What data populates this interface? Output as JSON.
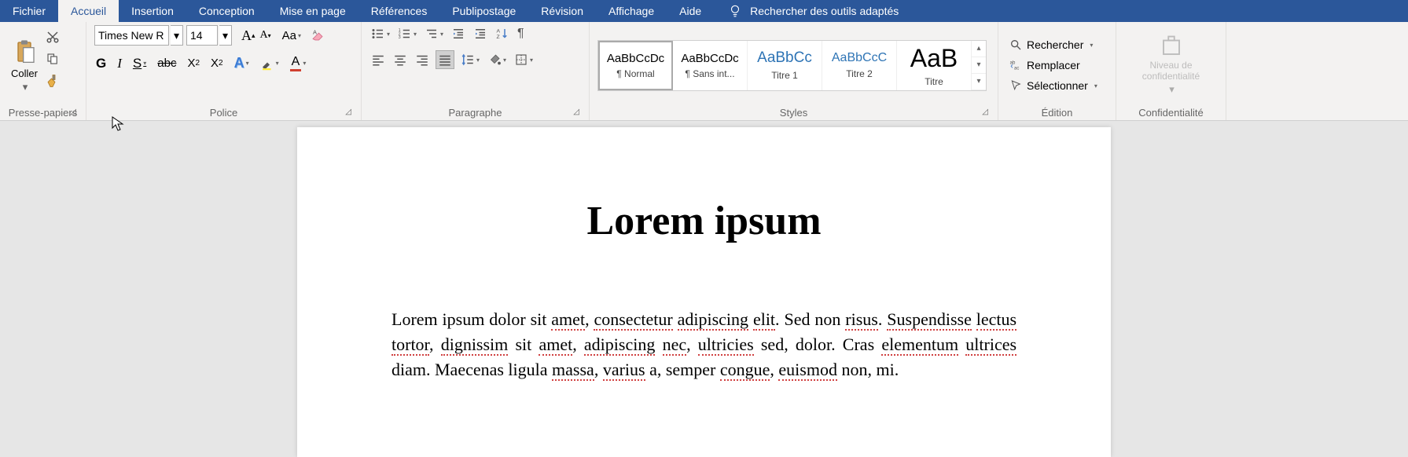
{
  "menu": {
    "fichier": "Fichier",
    "accueil": "Accueil",
    "insertion": "Insertion",
    "conception": "Conception",
    "mise_en_page": "Mise en page",
    "references": "Références",
    "publipostage": "Publipostage",
    "revision": "Révision",
    "affichage": "Affichage",
    "aide": "Aide",
    "tell_me": "Rechercher des outils adaptés"
  },
  "clipboard": {
    "paste": "Coller",
    "group": "Presse-papiers"
  },
  "font": {
    "name": "Times New R",
    "size": "14",
    "group": "Police"
  },
  "paragraph": {
    "group": "Paragraphe"
  },
  "styles": {
    "group": "Styles",
    "items": [
      {
        "preview": "AaBbCcDc",
        "label": "¶ Normal"
      },
      {
        "preview": "AaBbCcDc",
        "label": "¶ Sans int..."
      },
      {
        "preview": "AaBbCc",
        "label": "Titre 1"
      },
      {
        "preview": "AaBbCcC",
        "label": "Titre 2"
      },
      {
        "preview": "AaB",
        "label": "Titre"
      }
    ]
  },
  "editing": {
    "find": "Rechercher",
    "replace": "Remplacer",
    "select": "Sélectionner",
    "group": "Édition"
  },
  "sensitivity": {
    "label": "Niveau de confidentialité",
    "group": "Confidentialité"
  },
  "doc": {
    "title": "Lorem ipsum",
    "para": "Lorem ipsum dolor sit amet, consectetur adipiscing elit. Sed non risus. Suspendisse lectus tortor, dignissim sit amet, adipiscing nec, ultricies sed, dolor. Cras elementum ultrices diam. Maecenas ligula massa, varius a, semper congue, euismod non, mi."
  }
}
